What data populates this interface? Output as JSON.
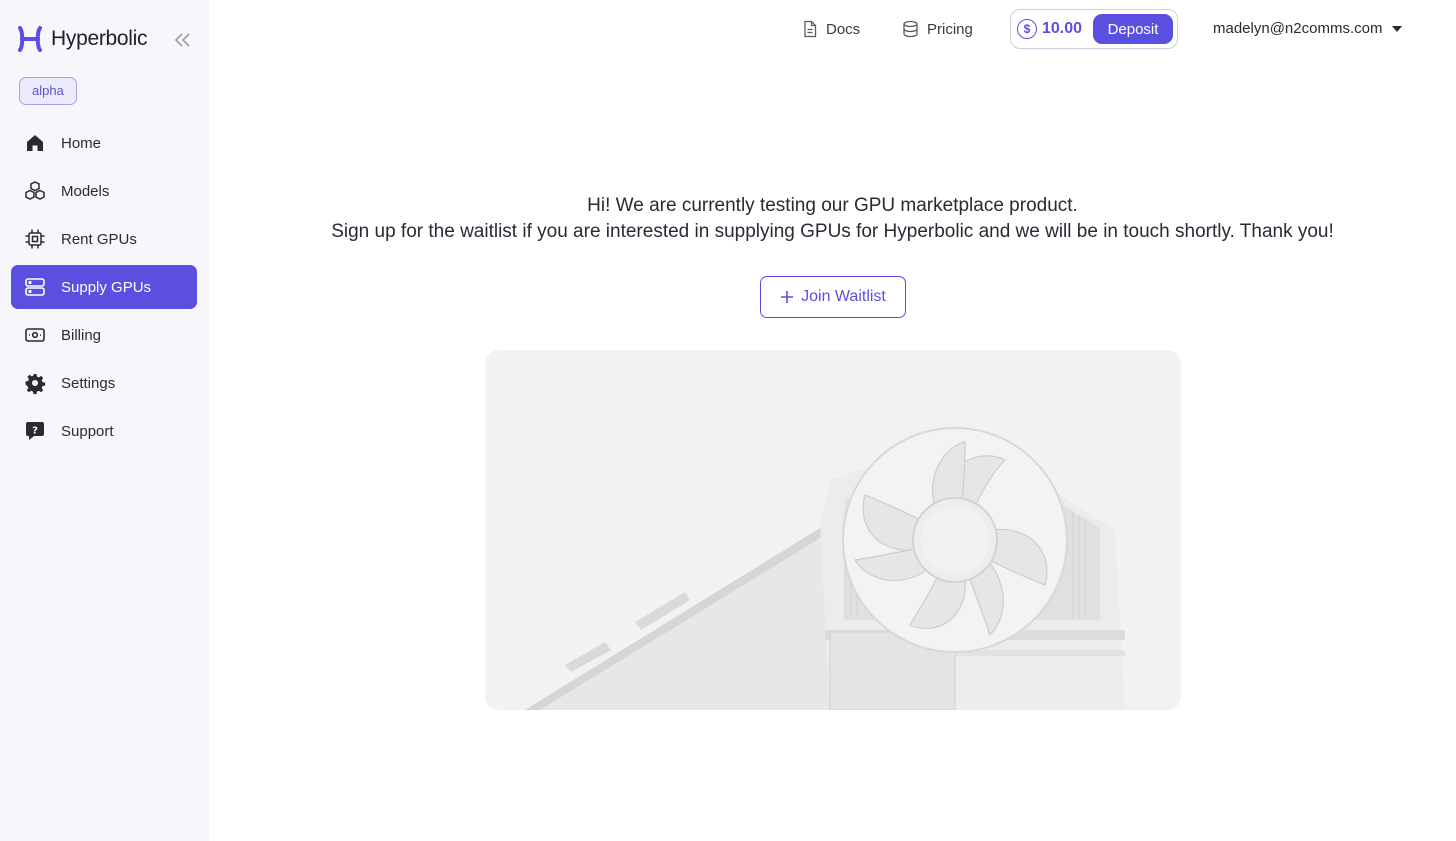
{
  "brand": {
    "name": "Hyperbolic",
    "badge": "alpha",
    "accent": "#5b4fe1"
  },
  "sidebar": {
    "items": [
      {
        "label": "Home",
        "icon": "home-icon"
      },
      {
        "label": "Models",
        "icon": "cubes-icon"
      },
      {
        "label": "Rent GPUs",
        "icon": "chip-icon"
      },
      {
        "label": "Supply GPUs",
        "icon": "server-icon",
        "active": true
      },
      {
        "label": "Billing",
        "icon": "cash-icon"
      },
      {
        "label": "Settings",
        "icon": "gear-icon"
      },
      {
        "label": "Support",
        "icon": "help-chat-icon"
      }
    ]
  },
  "header": {
    "docs_label": "Docs",
    "pricing_label": "Pricing",
    "balance": "10.00",
    "deposit_label": "Deposit",
    "user_email": "madelyn@n2comms.com"
  },
  "main": {
    "message_line1": "Hi! We are currently testing our GPU marketplace product.",
    "message_line2": "Sign up for the waitlist if you are interested in supplying GPUs for Hyperbolic and we will be in touch shortly. Thank you!",
    "join_label": "Join Waitlist"
  }
}
